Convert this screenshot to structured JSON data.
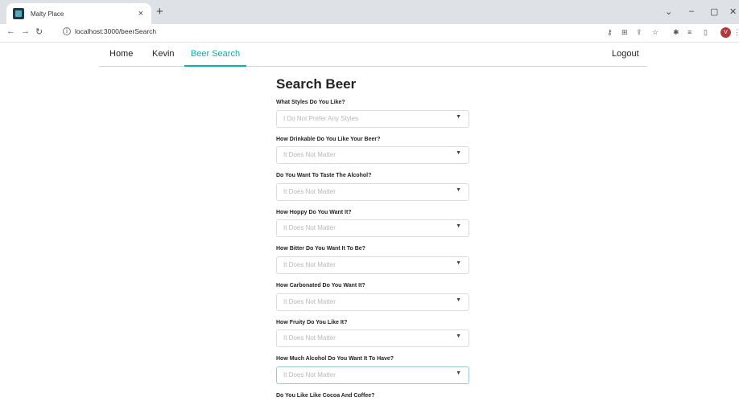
{
  "browser": {
    "tab_title": "Malty Place",
    "tab_close": "×",
    "new_tab": "+",
    "url": "localhost:3000/beerSearch",
    "avatar_letter": "V",
    "icons": [
      "back-icon",
      "forward-icon",
      "reload-icon",
      "info-icon",
      "key-icon",
      "translate-icon",
      "share-icon",
      "star-icon",
      "extensions-icon",
      "reading-list-icon",
      "sidepanel-icon",
      "menu-icon"
    ]
  },
  "nav": {
    "items": [
      {
        "label": "Home"
      },
      {
        "label": "Kevin"
      },
      {
        "label": "Beer Search",
        "active": true
      }
    ],
    "logout": "Logout",
    "accent": "#00b5ad"
  },
  "form": {
    "title": "Search Beer",
    "questions": [
      {
        "label": "What Styles Do You Like?",
        "placeholder": "I Do Not Prefer Any Styles"
      },
      {
        "label": "How Drinkable Do You Like Your Beer?",
        "placeholder": "It Does Not Matter"
      },
      {
        "label": "Do You Want To Taste The Alcohol?",
        "placeholder": "It Does Not Matter"
      },
      {
        "label": "How Hoppy Do You Want It?",
        "placeholder": "It Does Not Matter"
      },
      {
        "label": "How Bitter Do You Want It To Be?",
        "placeholder": "It Does Not Matter"
      },
      {
        "label": "How Carbonated Do You Want It?",
        "placeholder": "It Does Not Matter"
      },
      {
        "label": "How Fruity Do You Like It?",
        "placeholder": "It Does Not Matter"
      },
      {
        "label": "How Much Alcohol Do You Want It To Have?",
        "placeholder": "It Does Not Matter"
      },
      {
        "label": "Do You Like Like Cocoa And Coffee?"
      }
    ]
  }
}
